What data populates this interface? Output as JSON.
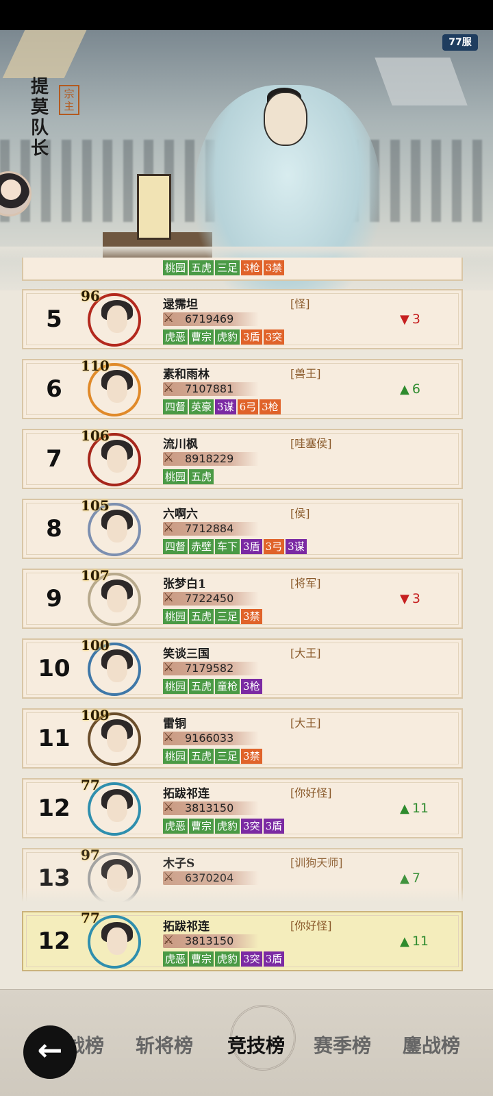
{
  "server_badge": "77服",
  "hero": {
    "role_name": "提莫队长",
    "role_tag": "宗主"
  },
  "partial_top_tags": [
    {
      "text": "桃园",
      "color": "green"
    },
    {
      "text": "五虎",
      "color": "green"
    },
    {
      "text": "三足",
      "color": "green"
    },
    {
      "text": "3枪",
      "color": "orange"
    },
    {
      "text": "3禁",
      "color": "orange"
    }
  ],
  "rows": [
    {
      "rank": "5",
      "level": "96",
      "name": "逯霈坦",
      "title": "[怪]",
      "power": "6719469",
      "tags": [
        {
          "text": "虎恶",
          "color": "green"
        },
        {
          "text": "曹宗",
          "color": "green"
        },
        {
          "text": "虎豹",
          "color": "green"
        },
        {
          "text": "3盾",
          "color": "orange"
        },
        {
          "text": "3突",
          "color": "orange"
        }
      ],
      "change": {
        "dir": "down",
        "value": "3"
      },
      "frame": "#b3291e"
    },
    {
      "rank": "6",
      "level": "110",
      "name": "素和雨林",
      "title": "[兽王]",
      "power": "7107881",
      "tags": [
        {
          "text": "四督",
          "color": "green"
        },
        {
          "text": "英豪",
          "color": "green"
        },
        {
          "text": "3谋",
          "color": "purple"
        },
        {
          "text": "6弓",
          "color": "orange"
        },
        {
          "text": "3枪",
          "color": "orange"
        }
      ],
      "change": {
        "dir": "up",
        "value": "6"
      },
      "frame": "#e08a2a"
    },
    {
      "rank": "7",
      "level": "106",
      "name": "流川枫",
      "title": "[哇塞侯]",
      "power": "8918229",
      "tags": [
        {
          "text": "桃园",
          "color": "green"
        },
        {
          "text": "五虎",
          "color": "green"
        }
      ],
      "change": null,
      "frame": "#a6261b"
    },
    {
      "rank": "8",
      "level": "105",
      "name": "六啊六",
      "title": "[侯]",
      "power": "7712884",
      "tags": [
        {
          "text": "四督",
          "color": "green"
        },
        {
          "text": "赤壁",
          "color": "green"
        },
        {
          "text": "车下",
          "color": "green"
        },
        {
          "text": "3盾",
          "color": "purple"
        },
        {
          "text": "3弓",
          "color": "orange"
        },
        {
          "text": "3谋",
          "color": "purple"
        }
      ],
      "change": null,
      "frame": "#7c8fb0"
    },
    {
      "rank": "9",
      "level": "107",
      "name": "张梦白1",
      "title": "[将军]",
      "power": "7722450",
      "tags": [
        {
          "text": "桃园",
          "color": "green"
        },
        {
          "text": "五虎",
          "color": "green"
        },
        {
          "text": "三足",
          "color": "green"
        },
        {
          "text": "3禁",
          "color": "orange"
        }
      ],
      "change": {
        "dir": "down",
        "value": "3"
      },
      "frame": "#b7a98c"
    },
    {
      "rank": "10",
      "level": "100",
      "name": "笑谈三国",
      "title": "[大王]",
      "power": "7179582",
      "tags": [
        {
          "text": "桃园",
          "color": "green"
        },
        {
          "text": "五虎",
          "color": "green"
        },
        {
          "text": "童枪",
          "color": "green"
        },
        {
          "text": "3枪",
          "color": "purple"
        }
      ],
      "change": null,
      "frame": "#3f78a8"
    },
    {
      "rank": "11",
      "level": "109",
      "name": "雷铜",
      "title": "[大王]",
      "power": "9166033",
      "tags": [
        {
          "text": "桃园",
          "color": "green"
        },
        {
          "text": "五虎",
          "color": "green"
        },
        {
          "text": "三足",
          "color": "green"
        },
        {
          "text": "3禁",
          "color": "orange"
        }
      ],
      "change": null,
      "frame": "#6b4e2c"
    },
    {
      "rank": "12",
      "level": "77",
      "name": "拓跋祁连",
      "title": "[你好怪]",
      "power": "3813150",
      "tags": [
        {
          "text": "虎恶",
          "color": "green"
        },
        {
          "text": "曹宗",
          "color": "green"
        },
        {
          "text": "虎豹",
          "color": "green"
        },
        {
          "text": "3突",
          "color": "purple"
        },
        {
          "text": "3盾",
          "color": "purple"
        }
      ],
      "change": {
        "dir": "up",
        "value": "11"
      },
      "frame": "#2f8fae"
    },
    {
      "rank": "13",
      "level": "97",
      "name": "木子S",
      "title": "[训狗天师]",
      "power": "6370204",
      "tags": [],
      "change": {
        "dir": "up",
        "value": "7"
      },
      "frame": "#9c9c9c"
    }
  ],
  "my_row": {
    "rank": "12",
    "level": "77",
    "name": "拓跋祁连",
    "title": "[你好怪]",
    "power": "3813150",
    "tags": [
      {
        "text": "虎恶",
        "color": "green"
      },
      {
        "text": "曹宗",
        "color": "green"
      },
      {
        "text": "虎豹",
        "color": "green"
      },
      {
        "text": "3突",
        "color": "purple"
      },
      {
        "text": "3盾",
        "color": "purple"
      }
    ],
    "change": {
      "dir": "up",
      "value": "11"
    },
    "frame": "#2f8fae"
  },
  "nav": {
    "back_icon": "back-arrow-icon",
    "tabs": [
      "战榜",
      "斩将榜",
      "竞技榜",
      "赛季榜",
      "鏖战榜"
    ],
    "active_index": 2
  }
}
